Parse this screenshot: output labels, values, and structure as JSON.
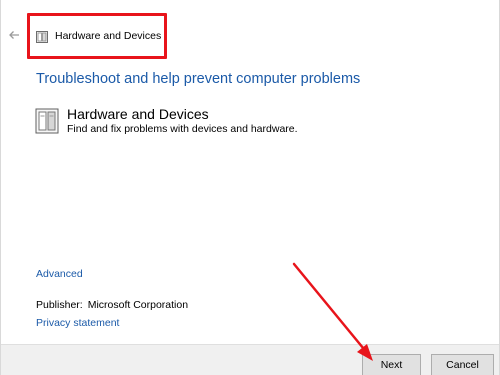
{
  "header": {
    "title": "Hardware and Devices",
    "back_icon": "back-arrow-icon",
    "title_icon": "hardware-devices-icon"
  },
  "main": {
    "heading": "Troubleshoot and help prevent computer problems",
    "item": {
      "icon": "hardware-devices-icon",
      "title": "Hardware and Devices",
      "description": "Find and fix problems with devices and hardware."
    },
    "advanced_link": "Advanced",
    "publisher_label": "Publisher:",
    "publisher_value": "Microsoft Corporation",
    "privacy_link": "Privacy statement"
  },
  "footer": {
    "next_label": "Next",
    "cancel_label": "Cancel"
  },
  "colors": {
    "link": "#1b5aa8",
    "highlight": "#e8141b",
    "footer_bg": "#f0f0f0"
  }
}
